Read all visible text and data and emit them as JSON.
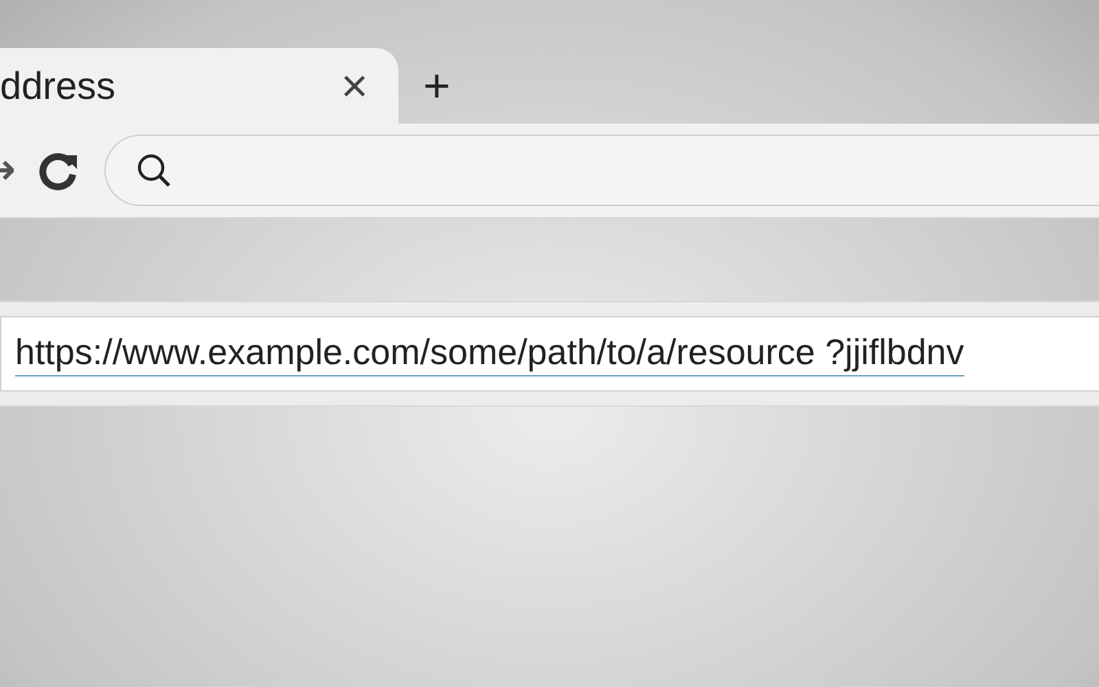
{
  "tab": {
    "title": "ddress",
    "close": "×"
  },
  "new_tab": "+",
  "url_bar": {
    "value": "https://www.example.com/some/path/to/a/resource ?jjiflbdnv"
  }
}
